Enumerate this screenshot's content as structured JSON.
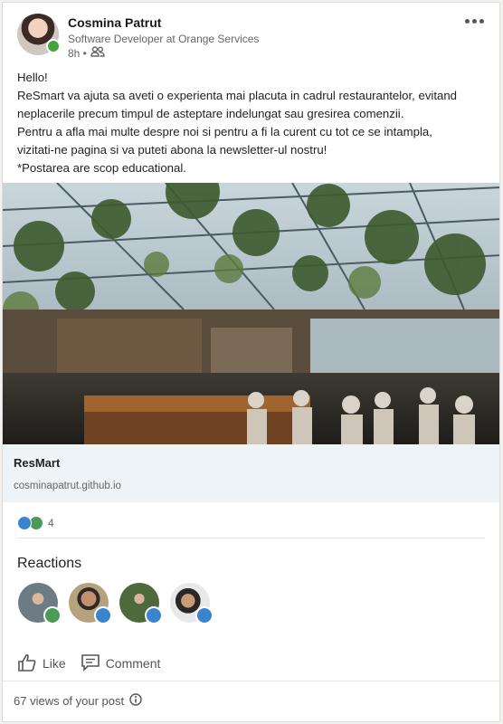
{
  "author": {
    "name": "Cosmina Patrut",
    "headline": "Software Developer at Orange Services",
    "time": "8h •",
    "visibility_icon": "connections-icon"
  },
  "post": {
    "lines": [
      "Hello!",
      "ReSmart va ajuta sa aveti o experienta mai placuta in cadrul restaurantelor, evitand",
      "neplacerile precum timpul de asteptare indelungat sau gresirea comenzii.",
      "Pentru a afla mai multe despre noi si pentru a fi la curent cu tot ce se intampla,",
      "vizitati-ne pagina si va puteti abona la newsletter-ul nostru!",
      "*Postarea are scop educational."
    ]
  },
  "link_preview": {
    "title": "ResMart",
    "url": "cosminapatrut.github.io"
  },
  "reactions": {
    "count": "4",
    "heading": "Reactions",
    "types": [
      "like",
      "celebrate"
    ]
  },
  "actions": {
    "like_label": "Like",
    "comment_label": "Comment"
  },
  "views": {
    "text": "67 views of your post"
  }
}
